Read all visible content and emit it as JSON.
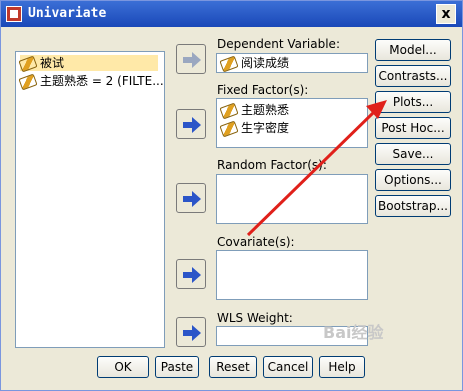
{
  "window": {
    "title": "Univariate",
    "close_glyph": "x"
  },
  "variable_list": {
    "items": [
      "被试",
      "主题熟悉 = 2 (FILTE..."
    ]
  },
  "dependent": {
    "label": "Dependent Variable:",
    "value": "阅读成绩"
  },
  "fixed": {
    "label": "Fixed Factor(s):",
    "items": [
      "主题熟悉",
      "生字密度"
    ]
  },
  "random": {
    "label": "Random Factor(s):"
  },
  "covariate": {
    "label": "Covariate(s):"
  },
  "wls": {
    "label": "WLS Weight:"
  },
  "side_buttons": [
    "Model...",
    "Contrasts...",
    "Plots...",
    "Post Hoc...",
    "Save...",
    "Options...",
    "Bootstrap..."
  ],
  "bottom_buttons": [
    "OK",
    "Paste",
    "Reset",
    "Cancel",
    "Help"
  ],
  "watermark": "Bai经验",
  "annotation": {
    "arrow_color": "#e0201a"
  }
}
